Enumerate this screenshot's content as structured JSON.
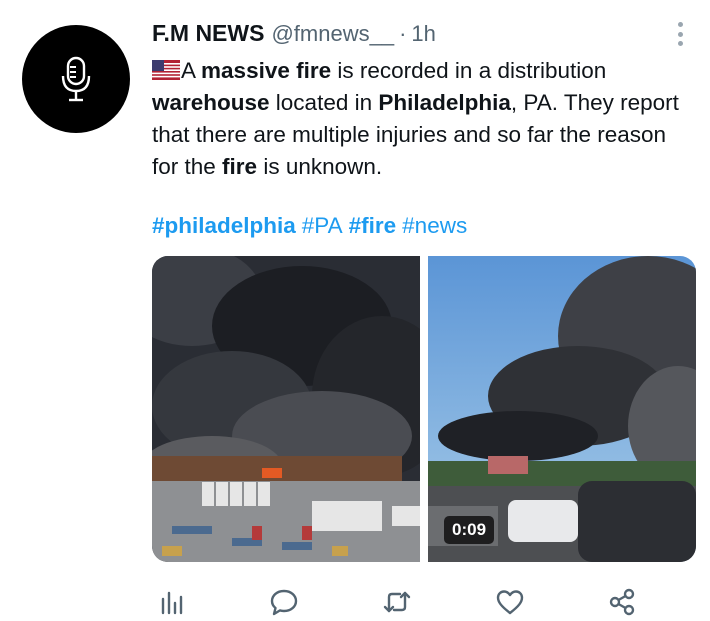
{
  "tweet": {
    "author_name": "F.M NEWS",
    "handle": "@fmnews__",
    "separator": "·",
    "time": "1h",
    "text_parts": [
      {
        "t": "A ",
        "b": false
      },
      {
        "t": "massive fire",
        "b": true
      },
      {
        "t": " is recorded in a distribution ",
        "b": false
      },
      {
        "t": "warehouse",
        "b": true
      },
      {
        "t": " located in ",
        "b": false
      },
      {
        "t": "Philadelphia",
        "b": true
      },
      {
        "t": ", PA. They report that there are multiple injuries and so far the reason for the ",
        "b": false
      },
      {
        "t": "fire",
        "b": true
      },
      {
        "t": " is unknown.",
        "b": false
      }
    ],
    "hashtags": [
      {
        "t": "#philadelphia",
        "b": true
      },
      {
        "t": "#PA",
        "b": false
      },
      {
        "t": "#fire",
        "b": true
      },
      {
        "t": "#news",
        "b": false
      }
    ],
    "video_duration": "0:09"
  },
  "icons": {
    "avatar": "microphone-icon",
    "flag": "us-flag-icon",
    "more": "more-vertical-icon",
    "analytics": "analytics-icon",
    "reply": "reply-icon",
    "retweet": "retweet-icon",
    "like": "heart-icon",
    "share": "share-icon"
  },
  "colors": {
    "link": "#1d9bf0",
    "secondary_text": "#536471",
    "icon": "#536471",
    "primary_text": "#0f1419"
  }
}
